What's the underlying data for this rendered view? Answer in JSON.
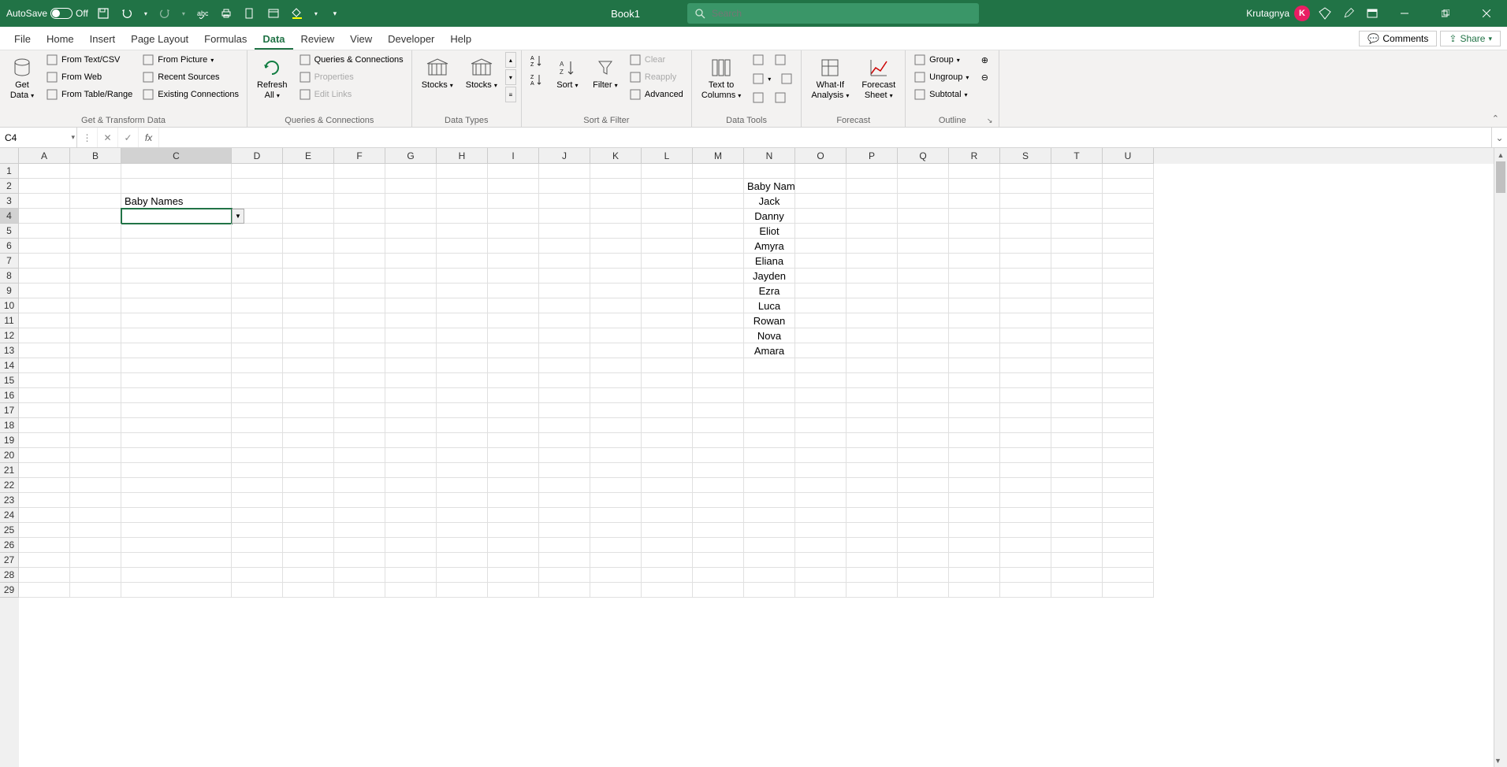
{
  "titlebar": {
    "autosave_label": "AutoSave",
    "autosave_state": "Off",
    "book_title": "Book1",
    "search_placeholder": "Search",
    "user_name": "Krutagnya",
    "user_initial": "K"
  },
  "tabs": {
    "items": [
      "File",
      "Home",
      "Insert",
      "Page Layout",
      "Formulas",
      "Data",
      "Review",
      "View",
      "Developer",
      "Help"
    ],
    "active_index": 5,
    "comments": "Comments",
    "share": "Share"
  },
  "ribbon": {
    "groups": [
      {
        "label": "Get & Transform Data",
        "big": [
          {
            "label": "Get\nData"
          }
        ],
        "cols": [
          [
            {
              "label": "From Text/CSV"
            },
            {
              "label": "From Web"
            },
            {
              "label": "From Table/Range"
            }
          ],
          [
            {
              "label": "From Picture"
            },
            {
              "label": "Recent Sources"
            },
            {
              "label": "Existing Connections"
            }
          ]
        ]
      },
      {
        "label": "Queries & Connections",
        "big": [
          {
            "label": "Refresh\nAll"
          }
        ],
        "cols": [
          [
            {
              "label": "Queries & Connections"
            },
            {
              "label": "Properties",
              "disabled": true
            },
            {
              "label": "Edit Links",
              "disabled": true
            }
          ]
        ]
      },
      {
        "label": "Data Types",
        "big": [
          {
            "label": "Stocks"
          },
          {
            "label": "Stocks"
          }
        ]
      },
      {
        "label": "Sort & Filter",
        "big": [
          {
            "label": "Sort"
          },
          {
            "label": "Filter"
          }
        ],
        "cols": [
          [
            {
              "label": "Clear",
              "disabled": true
            },
            {
              "label": "Reapply",
              "disabled": true
            },
            {
              "label": "Advanced"
            }
          ]
        ]
      },
      {
        "label": "Data Tools",
        "big": [
          {
            "label": "Text to\nColumns"
          }
        ]
      },
      {
        "label": "Forecast",
        "big": [
          {
            "label": "What-If\nAnalysis"
          },
          {
            "label": "Forecast\nSheet"
          }
        ]
      },
      {
        "label": "Outline",
        "cols": [
          [
            {
              "label": "Group"
            },
            {
              "label": "Ungroup"
            },
            {
              "label": "Subtotal"
            }
          ]
        ]
      }
    ]
  },
  "formula_bar": {
    "name_box": "C4",
    "formula": ""
  },
  "grid": {
    "columns": [
      "A",
      "B",
      "C",
      "D",
      "E",
      "F",
      "G",
      "H",
      "I",
      "J",
      "K",
      "L",
      "M",
      "N",
      "O",
      "P",
      "Q",
      "R",
      "S",
      "T",
      "U"
    ],
    "selected_col": "C",
    "selected_row": 4,
    "row_count": 29,
    "col_width_default": 65,
    "col_width_c": 140,
    "cells": {
      "C3": "Baby Names",
      "N2": "Baby Names",
      "N3": "Jack",
      "N4": "Danny",
      "N5": "Eliot",
      "N6": "Amyra",
      "N7": "Eliana",
      "N8": "Jayden",
      "N9": "Ezra",
      "N10": "Luca",
      "N11": "Rowan",
      "N12": "Nova",
      "N13": "Amara"
    }
  }
}
